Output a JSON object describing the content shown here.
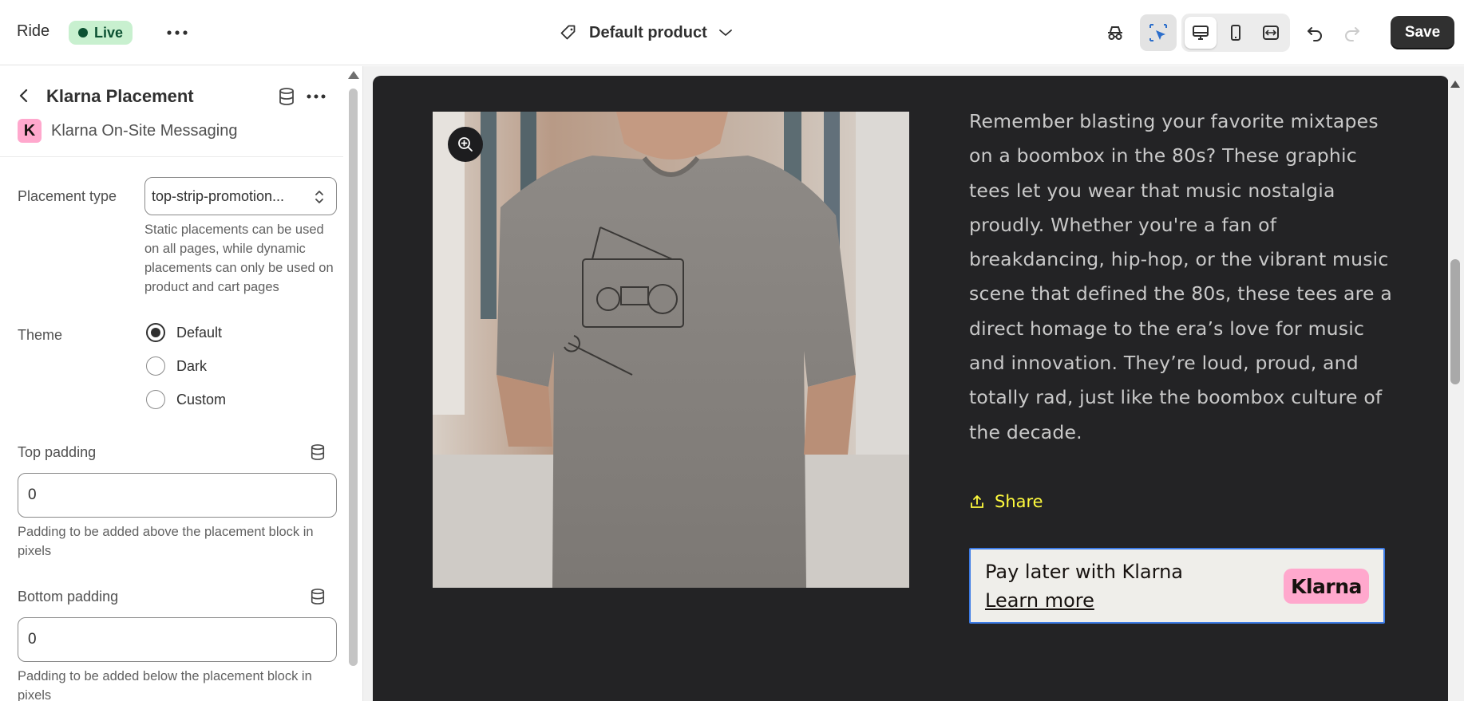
{
  "topbar": {
    "store_name": "Ride",
    "status_badge": "Live",
    "template_selector": "Default product",
    "save_label": "Save"
  },
  "block": {
    "title": "Klarna Placement",
    "app_name": "Klarna On-Site Messaging",
    "app_logo_letter": "K"
  },
  "settings": {
    "placement_type": {
      "label": "Placement type",
      "value": "top-strip-promotion...",
      "help": "Static placements can be used on all pages, while dynamic placements can only be used on product and cart pages"
    },
    "theme": {
      "label": "Theme",
      "options": [
        {
          "label": "Default",
          "checked": true
        },
        {
          "label": "Dark",
          "checked": false
        },
        {
          "label": "Custom",
          "checked": false
        }
      ]
    },
    "top_padding": {
      "label": "Top padding",
      "value": "0",
      "help": "Padding to be added above the placement block in pixels"
    },
    "bottom_padding": {
      "label": "Bottom padding",
      "value": "0",
      "help": "Padding to be added below the placement block in pixels"
    }
  },
  "preview": {
    "description_lines": [
      "Remember blasting your favorite mixtapes",
      "on a boombox in the 80s? These graphic",
      "tees let you wear that music nostalgia",
      "proudly. Whether you're a fan of",
      "breakdancing, hip-hop, or the vibrant music",
      "scene that defined the 80s, these tees are a",
      "direct homage to the era’s love for music",
      "and innovation. They’re loud, proud, and",
      "totally rad, just like the boombox culture of",
      "the decade."
    ],
    "share_label": "Share",
    "klarna": {
      "message": "Pay later with Klarna",
      "link": "Learn more",
      "logo_text": "Klarna"
    }
  },
  "colors": {
    "preview_bg": "#232325",
    "share_accent": "#fffb3d",
    "klarna_pink": "#ffa8cd",
    "selection_blue": "#3c7be6",
    "live_badge_bg": "#c8f0cf"
  }
}
